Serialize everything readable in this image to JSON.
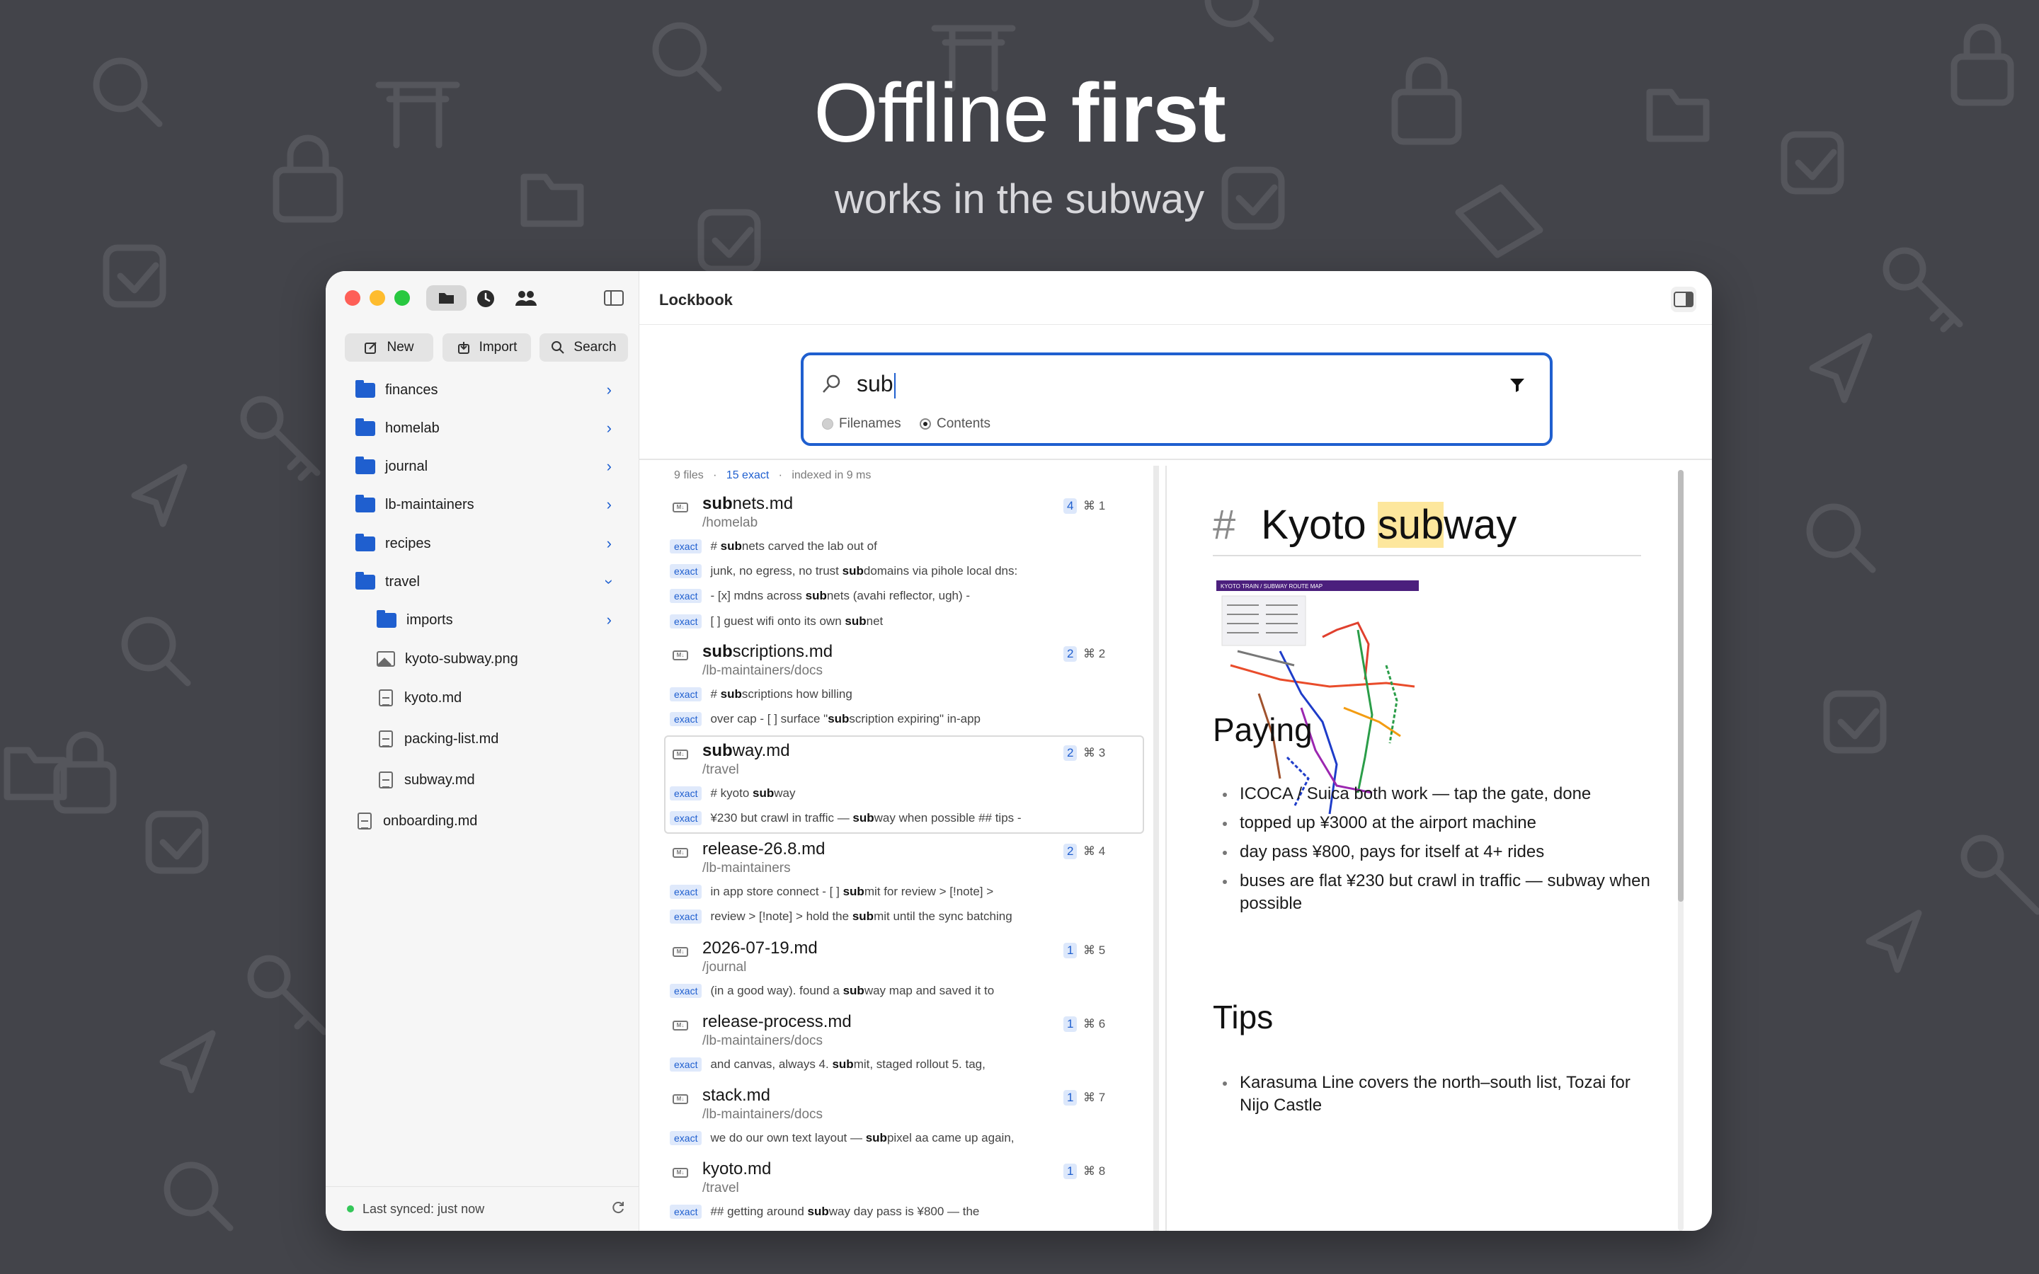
{
  "hero": {
    "title_regular": "Offline",
    "title_bold": "first",
    "subtitle": "works in the subway"
  },
  "window": {
    "title": "Lockbook"
  },
  "toolbar": {
    "new_label": "New",
    "import_label": "Import",
    "search_label": "Search"
  },
  "tree": {
    "folders": [
      {
        "label": "finances"
      },
      {
        "label": "homelab"
      },
      {
        "label": "journal"
      },
      {
        "label": "lb-maintainers"
      },
      {
        "label": "recipes"
      },
      {
        "label": "travel"
      }
    ],
    "travel_children": [
      {
        "label": "imports",
        "kind": "folder"
      },
      {
        "label": "kyoto-subway.png",
        "kind": "image"
      },
      {
        "label": "kyoto.md",
        "kind": "file"
      },
      {
        "label": "packing-list.md",
        "kind": "file"
      },
      {
        "label": "subway.md",
        "kind": "file"
      }
    ],
    "root_files": [
      {
        "label": "onboarding.md"
      }
    ]
  },
  "sync": {
    "status": "Last synced: just now"
  },
  "search": {
    "query": "sub",
    "mode_filenames": "Filenames",
    "mode_contents": "Contents",
    "stats_files": "9 files",
    "stats_exact": "15 exact",
    "stats_indexed": "indexed in 9 ms"
  },
  "results": [
    {
      "name_match": "sub",
      "name_rest": "nets.md",
      "path": "/homelab",
      "count": "4",
      "key": "⌘ 1",
      "snippets": [
        {
          "tag": "exact",
          "pre": "# ",
          "match": "sub",
          "post": "nets  carved the lab out of"
        },
        {
          "tag": "exact",
          "pre": "junk, no egress, no trust  ",
          "match": "sub",
          "post": "domains via pihole local dns:"
        },
        {
          "tag": "exact",
          "pre": " - [x] mdns across ",
          "match": "sub",
          "post": "nets (avahi reflector, ugh) -"
        },
        {
          "tag": "exact",
          "pre": "[ ] guest wifi onto its own ",
          "match": "sub",
          "post": "net"
        }
      ]
    },
    {
      "name_match": "sub",
      "name_rest": "scriptions.md",
      "path": "/lb-maintainers/docs",
      "count": "2",
      "key": "⌘ 2",
      "snippets": [
        {
          "tag": "exact",
          "pre": "# ",
          "match": "sub",
          "post": "scriptions  how billing"
        },
        {
          "tag": "exact",
          "pre": "over cap  - [ ] surface \"",
          "match": "sub",
          "post": "scription expiring\" in-app"
        }
      ]
    },
    {
      "name_match": "sub",
      "name_rest": "way.md",
      "path": "/travel",
      "count": "2",
      "key": "⌘ 3",
      "snippets": [
        {
          "tag": "exact",
          "pre": " # kyoto ",
          "match": "sub",
          "post": "way"
        },
        {
          "tag": "exact",
          "pre": "¥230 but crawl in traffic — ",
          "match": "sub",
          "post": "way when possible  ## tips  -"
        }
      ]
    },
    {
      "name_match": "",
      "name_rest": "release-26.8.md",
      "path": "/lb-maintainers",
      "count": "2",
      "key": "⌘ 4",
      "snippets": [
        {
          "tag": "exact",
          "pre": "in app store connect - [ ] ",
          "match": "sub",
          "post": "mit for review  > [!note] >"
        },
        {
          "tag": "exact",
          "pre": "review  > [!note] > hold the ",
          "match": "sub",
          "post": "mit until the sync batching"
        }
      ]
    },
    {
      "name_match": "",
      "name_rest": "2026-07-19.md",
      "path": "/journal",
      "count": "1",
      "key": "⌘ 5",
      "snippets": [
        {
          "tag": "exact",
          "pre": "(in a good way). found a ",
          "match": "sub",
          "post": "way map and saved it to"
        }
      ]
    },
    {
      "name_match": "",
      "name_rest": "release-process.md",
      "path": "/lb-maintainers/docs",
      "count": "1",
      "key": "⌘ 6",
      "snippets": [
        {
          "tag": "exact",
          "pre": "and canvas, always 4. ",
          "match": "sub",
          "post": "mit, staged rollout 5. tag,"
        }
      ]
    },
    {
      "name_match": "",
      "name_rest": "stack.md",
      "path": "/lb-maintainers/docs",
      "count": "1",
      "key": "⌘ 7",
      "snippets": [
        {
          "tag": "exact",
          "pre": "we do our own text layout — ",
          "match": "sub",
          "post": "pixel aa came up again,"
        }
      ]
    },
    {
      "name_match": "",
      "name_rest": "kyoto.md",
      "path": "/travel",
      "count": "1",
      "key": "⌘ 8",
      "snippets": [
        {
          "tag": "exact",
          "pre": "## getting around  ",
          "match": "sub",
          "post": "way day pass is ¥800 — the"
        }
      ]
    }
  ],
  "preview": {
    "h1_hash": "#",
    "h1_pre": "Kyoto ",
    "h1_match": "sub",
    "h1_post": "way",
    "map_title": "KYOTO TRAIN / SUBWAY ROUTE MAP",
    "h2_paying": "Paying",
    "paying_items": [
      "ICOCA / Suica both work — tap the gate, done",
      "topped up ¥3000 at the airport machine",
      "day pass ¥800, pays for itself at 4+ rides",
      "buses are flat ¥230 but crawl in traffic — subway when possible"
    ],
    "h2_tips": "Tips",
    "tips_items": [
      "Karasuma Line covers the north–south list, Tozai for Nijo Castle"
    ]
  },
  "colors": {
    "accent": "#1f5fcf",
    "background": "#43444a",
    "highlight": "#fde79d"
  }
}
